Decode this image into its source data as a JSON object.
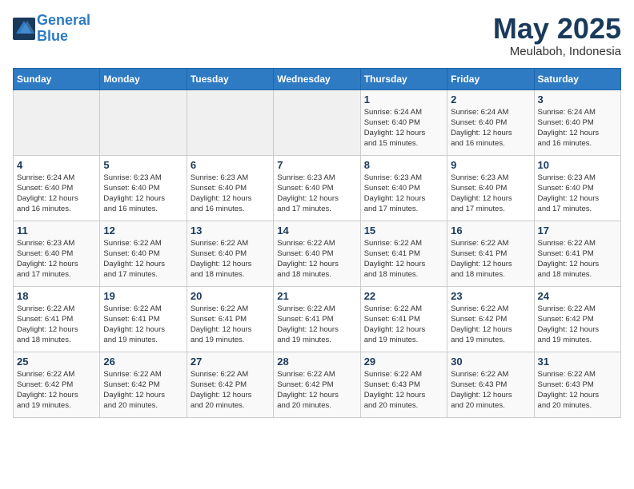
{
  "header": {
    "logo_line1": "General",
    "logo_line2": "Blue",
    "month": "May 2025",
    "location": "Meulaboh, Indonesia"
  },
  "weekdays": [
    "Sunday",
    "Monday",
    "Tuesday",
    "Wednesday",
    "Thursday",
    "Friday",
    "Saturday"
  ],
  "weeks": [
    [
      {
        "day": "",
        "info": ""
      },
      {
        "day": "",
        "info": ""
      },
      {
        "day": "",
        "info": ""
      },
      {
        "day": "",
        "info": ""
      },
      {
        "day": "1",
        "info": "Sunrise: 6:24 AM\nSunset: 6:40 PM\nDaylight: 12 hours\nand 15 minutes."
      },
      {
        "day": "2",
        "info": "Sunrise: 6:24 AM\nSunset: 6:40 PM\nDaylight: 12 hours\nand 16 minutes."
      },
      {
        "day": "3",
        "info": "Sunrise: 6:24 AM\nSunset: 6:40 PM\nDaylight: 12 hours\nand 16 minutes."
      }
    ],
    [
      {
        "day": "4",
        "info": "Sunrise: 6:24 AM\nSunset: 6:40 PM\nDaylight: 12 hours\nand 16 minutes."
      },
      {
        "day": "5",
        "info": "Sunrise: 6:23 AM\nSunset: 6:40 PM\nDaylight: 12 hours\nand 16 minutes."
      },
      {
        "day": "6",
        "info": "Sunrise: 6:23 AM\nSunset: 6:40 PM\nDaylight: 12 hours\nand 16 minutes."
      },
      {
        "day": "7",
        "info": "Sunrise: 6:23 AM\nSunset: 6:40 PM\nDaylight: 12 hours\nand 17 minutes."
      },
      {
        "day": "8",
        "info": "Sunrise: 6:23 AM\nSunset: 6:40 PM\nDaylight: 12 hours\nand 17 minutes."
      },
      {
        "day": "9",
        "info": "Sunrise: 6:23 AM\nSunset: 6:40 PM\nDaylight: 12 hours\nand 17 minutes."
      },
      {
        "day": "10",
        "info": "Sunrise: 6:23 AM\nSunset: 6:40 PM\nDaylight: 12 hours\nand 17 minutes."
      }
    ],
    [
      {
        "day": "11",
        "info": "Sunrise: 6:23 AM\nSunset: 6:40 PM\nDaylight: 12 hours\nand 17 minutes."
      },
      {
        "day": "12",
        "info": "Sunrise: 6:22 AM\nSunset: 6:40 PM\nDaylight: 12 hours\nand 17 minutes."
      },
      {
        "day": "13",
        "info": "Sunrise: 6:22 AM\nSunset: 6:40 PM\nDaylight: 12 hours\nand 18 minutes."
      },
      {
        "day": "14",
        "info": "Sunrise: 6:22 AM\nSunset: 6:40 PM\nDaylight: 12 hours\nand 18 minutes."
      },
      {
        "day": "15",
        "info": "Sunrise: 6:22 AM\nSunset: 6:41 PM\nDaylight: 12 hours\nand 18 minutes."
      },
      {
        "day": "16",
        "info": "Sunrise: 6:22 AM\nSunset: 6:41 PM\nDaylight: 12 hours\nand 18 minutes."
      },
      {
        "day": "17",
        "info": "Sunrise: 6:22 AM\nSunset: 6:41 PM\nDaylight: 12 hours\nand 18 minutes."
      }
    ],
    [
      {
        "day": "18",
        "info": "Sunrise: 6:22 AM\nSunset: 6:41 PM\nDaylight: 12 hours\nand 18 minutes."
      },
      {
        "day": "19",
        "info": "Sunrise: 6:22 AM\nSunset: 6:41 PM\nDaylight: 12 hours\nand 19 minutes."
      },
      {
        "day": "20",
        "info": "Sunrise: 6:22 AM\nSunset: 6:41 PM\nDaylight: 12 hours\nand 19 minutes."
      },
      {
        "day": "21",
        "info": "Sunrise: 6:22 AM\nSunset: 6:41 PM\nDaylight: 12 hours\nand 19 minutes."
      },
      {
        "day": "22",
        "info": "Sunrise: 6:22 AM\nSunset: 6:41 PM\nDaylight: 12 hours\nand 19 minutes."
      },
      {
        "day": "23",
        "info": "Sunrise: 6:22 AM\nSunset: 6:42 PM\nDaylight: 12 hours\nand 19 minutes."
      },
      {
        "day": "24",
        "info": "Sunrise: 6:22 AM\nSunset: 6:42 PM\nDaylight: 12 hours\nand 19 minutes."
      }
    ],
    [
      {
        "day": "25",
        "info": "Sunrise: 6:22 AM\nSunset: 6:42 PM\nDaylight: 12 hours\nand 19 minutes."
      },
      {
        "day": "26",
        "info": "Sunrise: 6:22 AM\nSunset: 6:42 PM\nDaylight: 12 hours\nand 20 minutes."
      },
      {
        "day": "27",
        "info": "Sunrise: 6:22 AM\nSunset: 6:42 PM\nDaylight: 12 hours\nand 20 minutes."
      },
      {
        "day": "28",
        "info": "Sunrise: 6:22 AM\nSunset: 6:42 PM\nDaylight: 12 hours\nand 20 minutes."
      },
      {
        "day": "29",
        "info": "Sunrise: 6:22 AM\nSunset: 6:43 PM\nDaylight: 12 hours\nand 20 minutes."
      },
      {
        "day": "30",
        "info": "Sunrise: 6:22 AM\nSunset: 6:43 PM\nDaylight: 12 hours\nand 20 minutes."
      },
      {
        "day": "31",
        "info": "Sunrise: 6:22 AM\nSunset: 6:43 PM\nDaylight: 12 hours\nand 20 minutes."
      }
    ]
  ]
}
